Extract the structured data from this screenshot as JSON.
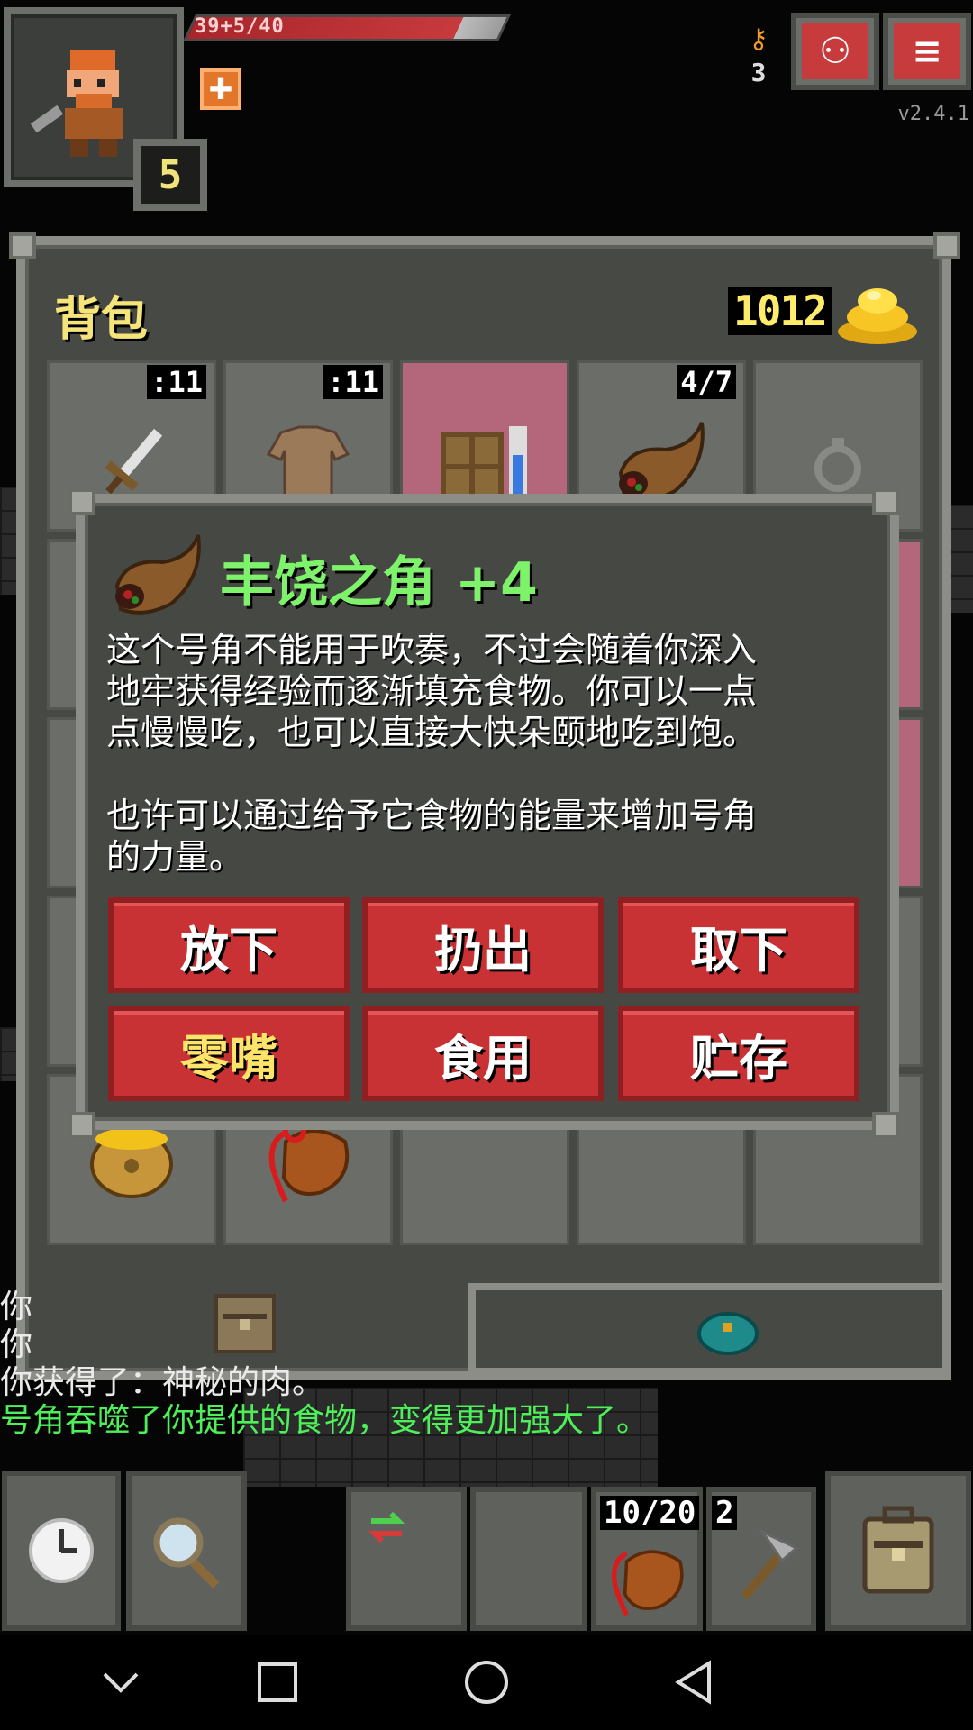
{
  "hud": {
    "hp_text": "39+5/40",
    "level": "5",
    "keys_count": "3",
    "version": "v2.4.1"
  },
  "bag": {
    "title": "背包",
    "gold": "1012",
    "slot_badges": [
      ":11",
      ":11",
      "",
      "4/7",
      "",
      "",
      "",
      "",
      "",
      "",
      "",
      "",
      "",
      "",
      "",
      "",
      "",
      "",
      "",
      "",
      "",
      "",
      "",
      "",
      ""
    ],
    "quickslot_badges": [
      "10/20",
      "2"
    ]
  },
  "item": {
    "title": "丰饶之角 +4",
    "description": "这个号角不能用于吹奏，不过会随着你深入\n地牢获得经验而逐渐填充食物。你可以一点\n点慢慢吃，也可以直接大快朵颐地吃到饱。\n\n也许可以通过给予它食物的能量来增加号角\n的力量。",
    "buttons": [
      "放下",
      "扔出",
      "取下",
      "零嘴",
      "食用",
      "贮存"
    ]
  },
  "log": {
    "lines": [
      "你",
      "你",
      "你获得了：神秘的肉。",
      "号角吞噬了你提供的食物，变得更加强大了。"
    ]
  },
  "colors": {
    "accent_red": "#c93234",
    "title_green": "#7df26a",
    "gold_yellow": "#ffeb6a",
    "log_green": "#4ef05a"
  },
  "icons": {
    "hud": [
      "hero-portrait-icon",
      "buff-icon",
      "key-icon",
      "journal-icon",
      "menu-icon"
    ],
    "toolbar": [
      "wait-clock-icon",
      "search-magnifier-icon",
      "swap-icon",
      "backpack-icon"
    ]
  }
}
